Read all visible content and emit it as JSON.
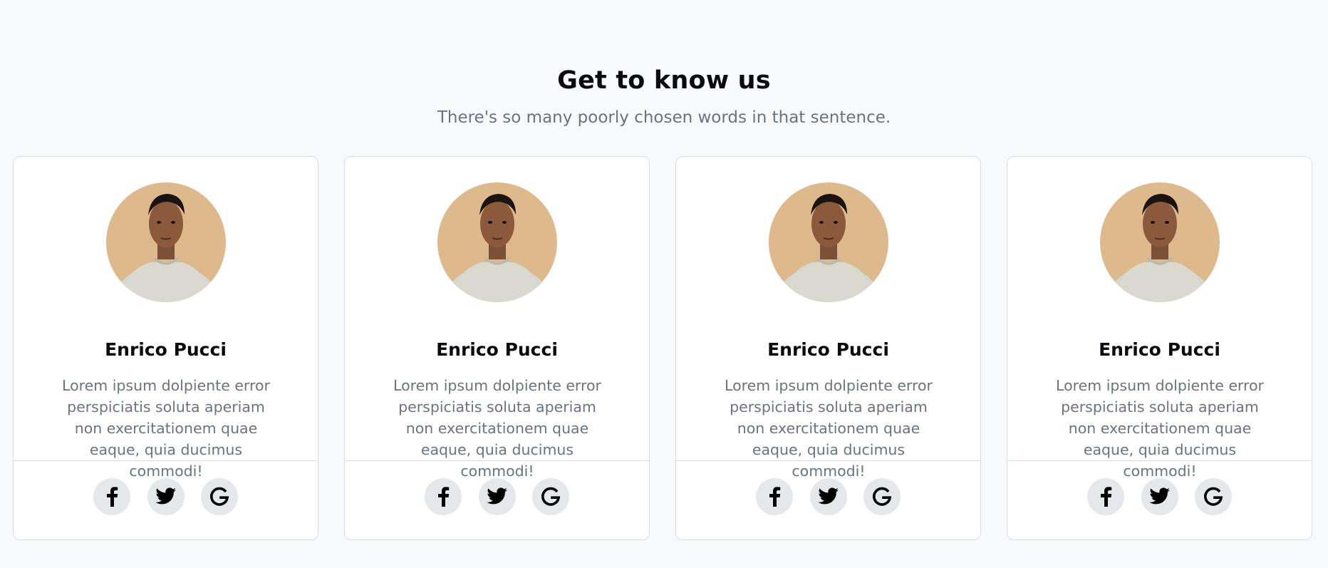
{
  "header": {
    "title": "Get to know us",
    "subtitle": "There's so many poorly chosen words in that sentence."
  },
  "cards": [
    {
      "name": "Enrico Pucci",
      "bio": "Lorem ipsum dolpiente error perspiciatis soluta aperiam non exercitationem quae eaque, quia ducimus commodi!",
      "social": [
        "facebook-icon",
        "twitter-icon",
        "google-icon"
      ]
    },
    {
      "name": "Enrico Pucci",
      "bio": "Lorem ipsum dolpiente error perspiciatis soluta aperiam non exercitationem quae eaque, quia ducimus commodi!",
      "social": [
        "facebook-icon",
        "twitter-icon",
        "google-icon"
      ]
    },
    {
      "name": "Enrico Pucci",
      "bio": "Lorem ipsum dolpiente error perspiciatis soluta aperiam non exercitationem quae eaque, quia ducimus commodi!",
      "social": [
        "facebook-icon",
        "twitter-icon",
        "google-icon"
      ]
    },
    {
      "name": "Enrico Pucci",
      "bio": "Lorem ipsum dolpiente error perspiciatis soluta aperiam non exercitationem quae eaque, quia ducimus commodi!",
      "social": [
        "facebook-icon",
        "twitter-icon",
        "google-icon"
      ]
    }
  ],
  "colors": {
    "page_background": "#f8f9fb",
    "card_background": "#ffffff",
    "border": "#d9dde3",
    "muted_text": "#6b7280",
    "icon_background": "#e5e7eb",
    "avatar_background": "#ddb98c"
  }
}
